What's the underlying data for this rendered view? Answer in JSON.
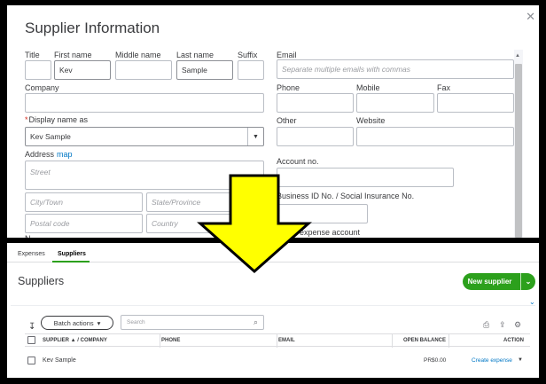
{
  "supplier_form": {
    "title": "Supplier Information",
    "labels": {
      "title": "Title",
      "first_name": "First name",
      "middle_name": "Middle name",
      "last_name": "Last name",
      "suffix": "Suffix",
      "email": "Email",
      "company": "Company",
      "phone": "Phone",
      "mobile": "Mobile",
      "fax": "Fax",
      "display_name_required": "*",
      "display_name": "Display name as",
      "other": "Other",
      "website": "Website",
      "address": "Address",
      "address_map": "map",
      "account_no": "Account no.",
      "business_id": "Business ID No. / Social Insurance No.",
      "default_expense_account": "ult expense account",
      "notes": "N"
    },
    "values": {
      "title": "",
      "first_name": "Kev",
      "middle_name": "",
      "last_name": "Sample",
      "suffix": "",
      "company": "",
      "display_name": "Kev Sample"
    },
    "placeholders": {
      "email": "Separate multiple emails with commas",
      "street": "Street",
      "city": "City/Town",
      "province": "State/Province",
      "postal": "Postal code",
      "country": "Country"
    }
  },
  "suppliers_page": {
    "tabs": [
      {
        "label": "Expenses",
        "active": false
      },
      {
        "label": "Suppliers",
        "active": true
      }
    ],
    "title": "Suppliers",
    "new_button": "New supplier",
    "batch_actions": "Batch actions",
    "search_placeholder": "Search",
    "columns": {
      "supplier": "SUPPLIER ▲ / COMPANY",
      "phone": "PHONE",
      "email": "EMAIL",
      "open_balance": "OPEN BALANCE",
      "action": "ACTION"
    },
    "rows": [
      {
        "supplier": "Kev Sample",
        "phone": "",
        "email": "",
        "open_balance": "PR$0.00",
        "action": "Create expense"
      }
    ]
  },
  "colors": {
    "accent_green": "#2ca01c",
    "link_blue": "#0077c5",
    "arrow_yellow": "#ffff00"
  },
  "icons": [
    "close-icon",
    "caret-down-icon",
    "scroll-up-icon",
    "sort-icon",
    "search-icon",
    "print-icon",
    "export-icon",
    "gear-icon",
    "down-arrow-icon"
  ]
}
